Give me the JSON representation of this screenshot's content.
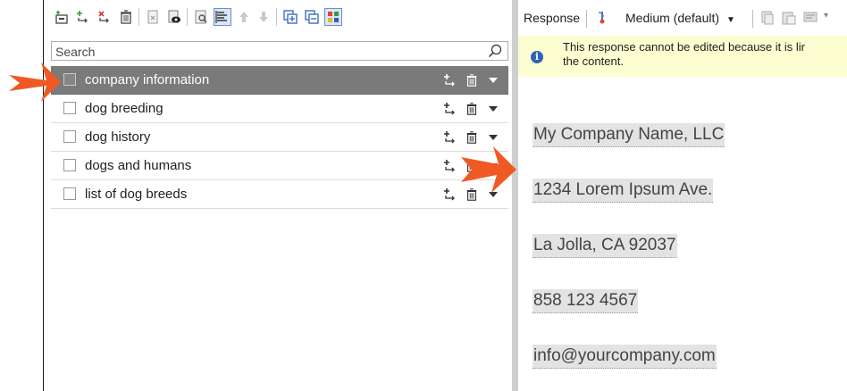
{
  "toolbar": {
    "buttons": [
      "new-topic-icon",
      "add-response-icon",
      "remove-response-icon",
      "delete-icon",
      "import-icon",
      "preview-icon",
      "properties-icon",
      "list-view-icon",
      "move-up-icon",
      "move-down-icon",
      "expand-all-icon",
      "collapse-all-icon",
      "color-grid-icon"
    ]
  },
  "search": {
    "placeholder": "Search"
  },
  "list": {
    "items": [
      {
        "label": "company information",
        "selected": true
      },
      {
        "label": "dog breeding",
        "selected": false
      },
      {
        "label": "dog history",
        "selected": false
      },
      {
        "label": "dogs and humans",
        "selected": false
      },
      {
        "label": "list of dog breeds",
        "selected": false
      }
    ]
  },
  "response_toolbar": {
    "response_label": "Response",
    "level_label": "Medium (default)"
  },
  "notice": {
    "text": "This response cannot be edited because it is lir\nthe content."
  },
  "content": {
    "lines": [
      "My Company Name, LLC",
      "1234 Lorem Ipsum Ave.",
      "La Jolla, CA 92037",
      "858 123 4567",
      "info@yourcompany.com"
    ]
  },
  "colors": {
    "selected_row": "#7a7a7a",
    "notice_bg": "#fdfdd2",
    "arrow": "#ef5a24",
    "accent_icon": "#2f63b8"
  }
}
